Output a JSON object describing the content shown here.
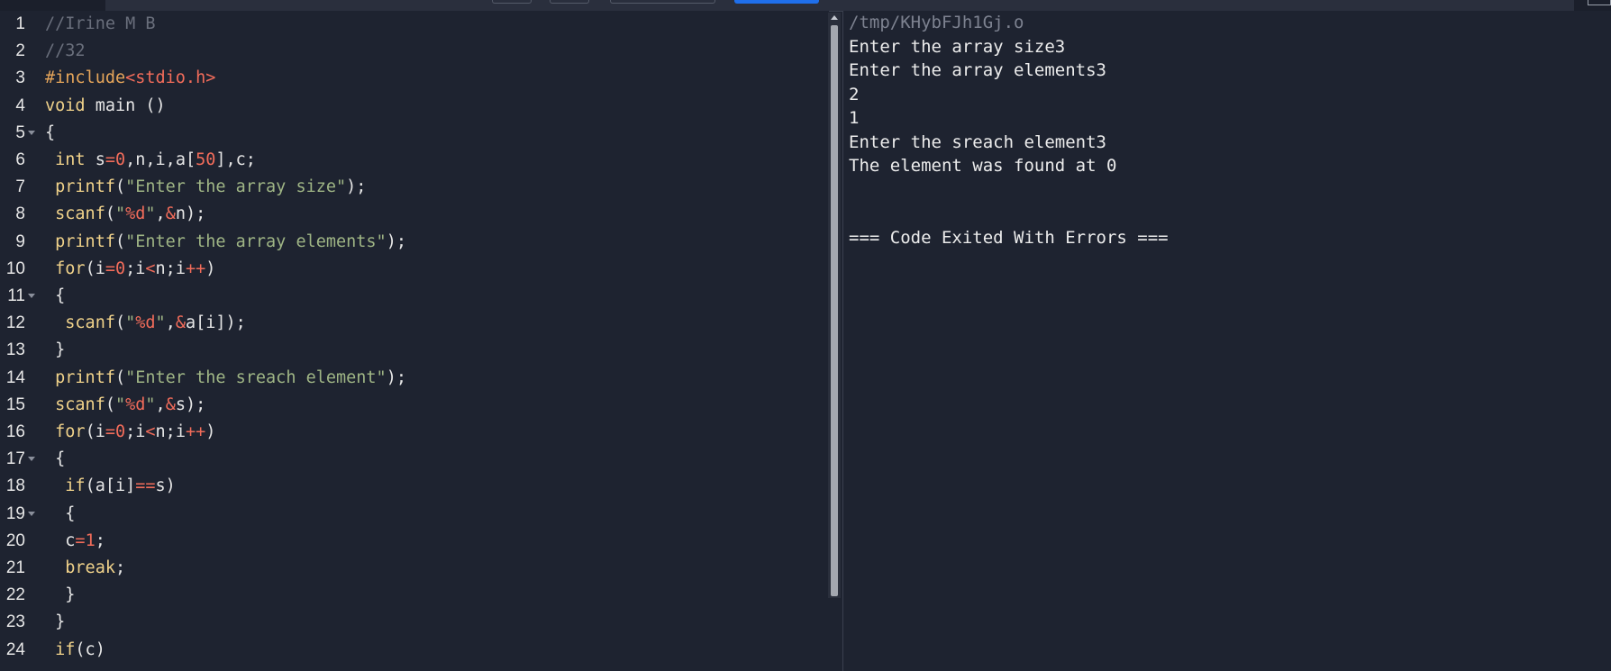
{
  "editor": {
    "lines": [
      {
        "n": "1",
        "fold": false,
        "tokens": [
          {
            "t": "//Irine M B",
            "c": "cm"
          }
        ]
      },
      {
        "n": "2",
        "fold": false,
        "tokens": [
          {
            "t": "//32",
            "c": "cm"
          }
        ]
      },
      {
        "n": "3",
        "fold": false,
        "tokens": [
          {
            "t": "#include",
            "c": "pp"
          },
          {
            "t": "<stdio.h>",
            "c": "ang"
          }
        ]
      },
      {
        "n": "4",
        "fold": false,
        "tokens": [
          {
            "t": "void",
            "c": "kw"
          },
          {
            "t": " main ()",
            "c": "id"
          }
        ]
      },
      {
        "n": "5",
        "fold": true,
        "tokens": [
          {
            "t": "{",
            "c": "id"
          }
        ]
      },
      {
        "n": "6",
        "fold": false,
        "tokens": [
          {
            "t": " ",
            "c": "id"
          },
          {
            "t": "int",
            "c": "kw"
          },
          {
            "t": " s",
            "c": "id"
          },
          {
            "t": "=",
            "c": "op"
          },
          {
            "t": "0",
            "c": "num"
          },
          {
            "t": ",n,i,a[",
            "c": "id"
          },
          {
            "t": "50",
            "c": "num"
          },
          {
            "t": "],c;",
            "c": "id"
          }
        ]
      },
      {
        "n": "7",
        "fold": false,
        "tokens": [
          {
            "t": " ",
            "c": "id"
          },
          {
            "t": "printf",
            "c": "fn"
          },
          {
            "t": "(",
            "c": "id"
          },
          {
            "t": "\"Enter the array size\"",
            "c": "str"
          },
          {
            "t": ");",
            "c": "id"
          }
        ]
      },
      {
        "n": "8",
        "fold": false,
        "tokens": [
          {
            "t": " ",
            "c": "id"
          },
          {
            "t": "scanf",
            "c": "fn"
          },
          {
            "t": "(",
            "c": "id"
          },
          {
            "t": "\"",
            "c": "str"
          },
          {
            "t": "%d",
            "c": "fmt"
          },
          {
            "t": "\"",
            "c": "str"
          },
          {
            "t": ",",
            "c": "id"
          },
          {
            "t": "&",
            "c": "op"
          },
          {
            "t": "n);",
            "c": "id"
          }
        ]
      },
      {
        "n": "9",
        "fold": false,
        "tokens": [
          {
            "t": " ",
            "c": "id"
          },
          {
            "t": "printf",
            "c": "fn"
          },
          {
            "t": "(",
            "c": "id"
          },
          {
            "t": "\"Enter the array elements\"",
            "c": "str"
          },
          {
            "t": ");",
            "c": "id"
          }
        ]
      },
      {
        "n": "10",
        "fold": false,
        "tokens": [
          {
            "t": " ",
            "c": "id"
          },
          {
            "t": "for",
            "c": "kw"
          },
          {
            "t": "(i",
            "c": "id"
          },
          {
            "t": "=",
            "c": "op"
          },
          {
            "t": "0",
            "c": "num"
          },
          {
            "t": ";i",
            "c": "id"
          },
          {
            "t": "<",
            "c": "op"
          },
          {
            "t": "n;i",
            "c": "id"
          },
          {
            "t": "++",
            "c": "op"
          },
          {
            "t": ")",
            "c": "id"
          }
        ]
      },
      {
        "n": "11",
        "fold": true,
        "tokens": [
          {
            "t": " {",
            "c": "id"
          }
        ]
      },
      {
        "n": "12",
        "fold": false,
        "tokens": [
          {
            "t": "  ",
            "c": "id"
          },
          {
            "t": "scanf",
            "c": "fn"
          },
          {
            "t": "(",
            "c": "id"
          },
          {
            "t": "\"",
            "c": "str"
          },
          {
            "t": "%d",
            "c": "fmt"
          },
          {
            "t": "\"",
            "c": "str"
          },
          {
            "t": ",",
            "c": "id"
          },
          {
            "t": "&",
            "c": "op"
          },
          {
            "t": "a[i]);",
            "c": "id"
          }
        ]
      },
      {
        "n": "13",
        "fold": false,
        "tokens": [
          {
            "t": " }",
            "c": "id"
          }
        ]
      },
      {
        "n": "14",
        "fold": false,
        "tokens": [
          {
            "t": " ",
            "c": "id"
          },
          {
            "t": "printf",
            "c": "fn"
          },
          {
            "t": "(",
            "c": "id"
          },
          {
            "t": "\"Enter the sreach element\"",
            "c": "str"
          },
          {
            "t": ");",
            "c": "id"
          }
        ]
      },
      {
        "n": "15",
        "fold": false,
        "tokens": [
          {
            "t": " ",
            "c": "id"
          },
          {
            "t": "scanf",
            "c": "fn"
          },
          {
            "t": "(",
            "c": "id"
          },
          {
            "t": "\"",
            "c": "str"
          },
          {
            "t": "%d",
            "c": "fmt"
          },
          {
            "t": "\"",
            "c": "str"
          },
          {
            "t": ",",
            "c": "id"
          },
          {
            "t": "&",
            "c": "op"
          },
          {
            "t": "s);",
            "c": "id"
          }
        ]
      },
      {
        "n": "16",
        "fold": false,
        "tokens": [
          {
            "t": " ",
            "c": "id"
          },
          {
            "t": "for",
            "c": "kw"
          },
          {
            "t": "(i",
            "c": "id"
          },
          {
            "t": "=",
            "c": "op"
          },
          {
            "t": "0",
            "c": "num"
          },
          {
            "t": ";i",
            "c": "id"
          },
          {
            "t": "<",
            "c": "op"
          },
          {
            "t": "n;i",
            "c": "id"
          },
          {
            "t": "++",
            "c": "op"
          },
          {
            "t": ")",
            "c": "id"
          }
        ]
      },
      {
        "n": "17",
        "fold": true,
        "tokens": [
          {
            "t": " {",
            "c": "id"
          }
        ]
      },
      {
        "n": "18",
        "fold": false,
        "tokens": [
          {
            "t": "  ",
            "c": "id"
          },
          {
            "t": "if",
            "c": "kw"
          },
          {
            "t": "(a[i]",
            "c": "id"
          },
          {
            "t": "==",
            "c": "op"
          },
          {
            "t": "s)",
            "c": "id"
          }
        ]
      },
      {
        "n": "19",
        "fold": true,
        "tokens": [
          {
            "t": "  {",
            "c": "id"
          }
        ]
      },
      {
        "n": "20",
        "fold": false,
        "tokens": [
          {
            "t": "  c",
            "c": "id"
          },
          {
            "t": "=",
            "c": "op"
          },
          {
            "t": "1",
            "c": "num"
          },
          {
            "t": ";",
            "c": "id"
          }
        ]
      },
      {
        "n": "21",
        "fold": false,
        "tokens": [
          {
            "t": "  ",
            "c": "id"
          },
          {
            "t": "break",
            "c": "kw"
          },
          {
            "t": ";",
            "c": "id"
          }
        ]
      },
      {
        "n": "22",
        "fold": false,
        "tokens": [
          {
            "t": "  }",
            "c": "id"
          }
        ]
      },
      {
        "n": "23",
        "fold": false,
        "tokens": [
          {
            "t": " }",
            "c": "id"
          }
        ]
      },
      {
        "n": "24",
        "fold": false,
        "tokens": [
          {
            "t": " ",
            "c": "id"
          },
          {
            "t": "if",
            "c": "kw"
          },
          {
            "t": "(c)",
            "c": "id"
          }
        ]
      }
    ]
  },
  "output": {
    "lines": [
      {
        "text": "/tmp/KHybFJh1Gj.o",
        "kind": "path"
      },
      {
        "text": "Enter the array size3",
        "kind": "out"
      },
      {
        "text": "Enter the array elements3",
        "kind": "out"
      },
      {
        "text": "2",
        "kind": "out"
      },
      {
        "text": "1",
        "kind": "out"
      },
      {
        "text": "Enter the sreach element3",
        "kind": "out"
      },
      {
        "text": "The element was found at 0",
        "kind": "out"
      },
      {
        "text": "",
        "kind": "out"
      },
      {
        "text": "",
        "kind": "out"
      },
      {
        "text": "=== Code Exited With Errors ===",
        "kind": "out"
      }
    ]
  },
  "colors": {
    "background": "#1e2330",
    "line_number": "#e6e6e6",
    "comment": "#6a6f7c",
    "keyword": "#f0d28a",
    "string": "#9fb585",
    "number_operator": "#f26c5a",
    "run_button": "#1f6feb"
  }
}
